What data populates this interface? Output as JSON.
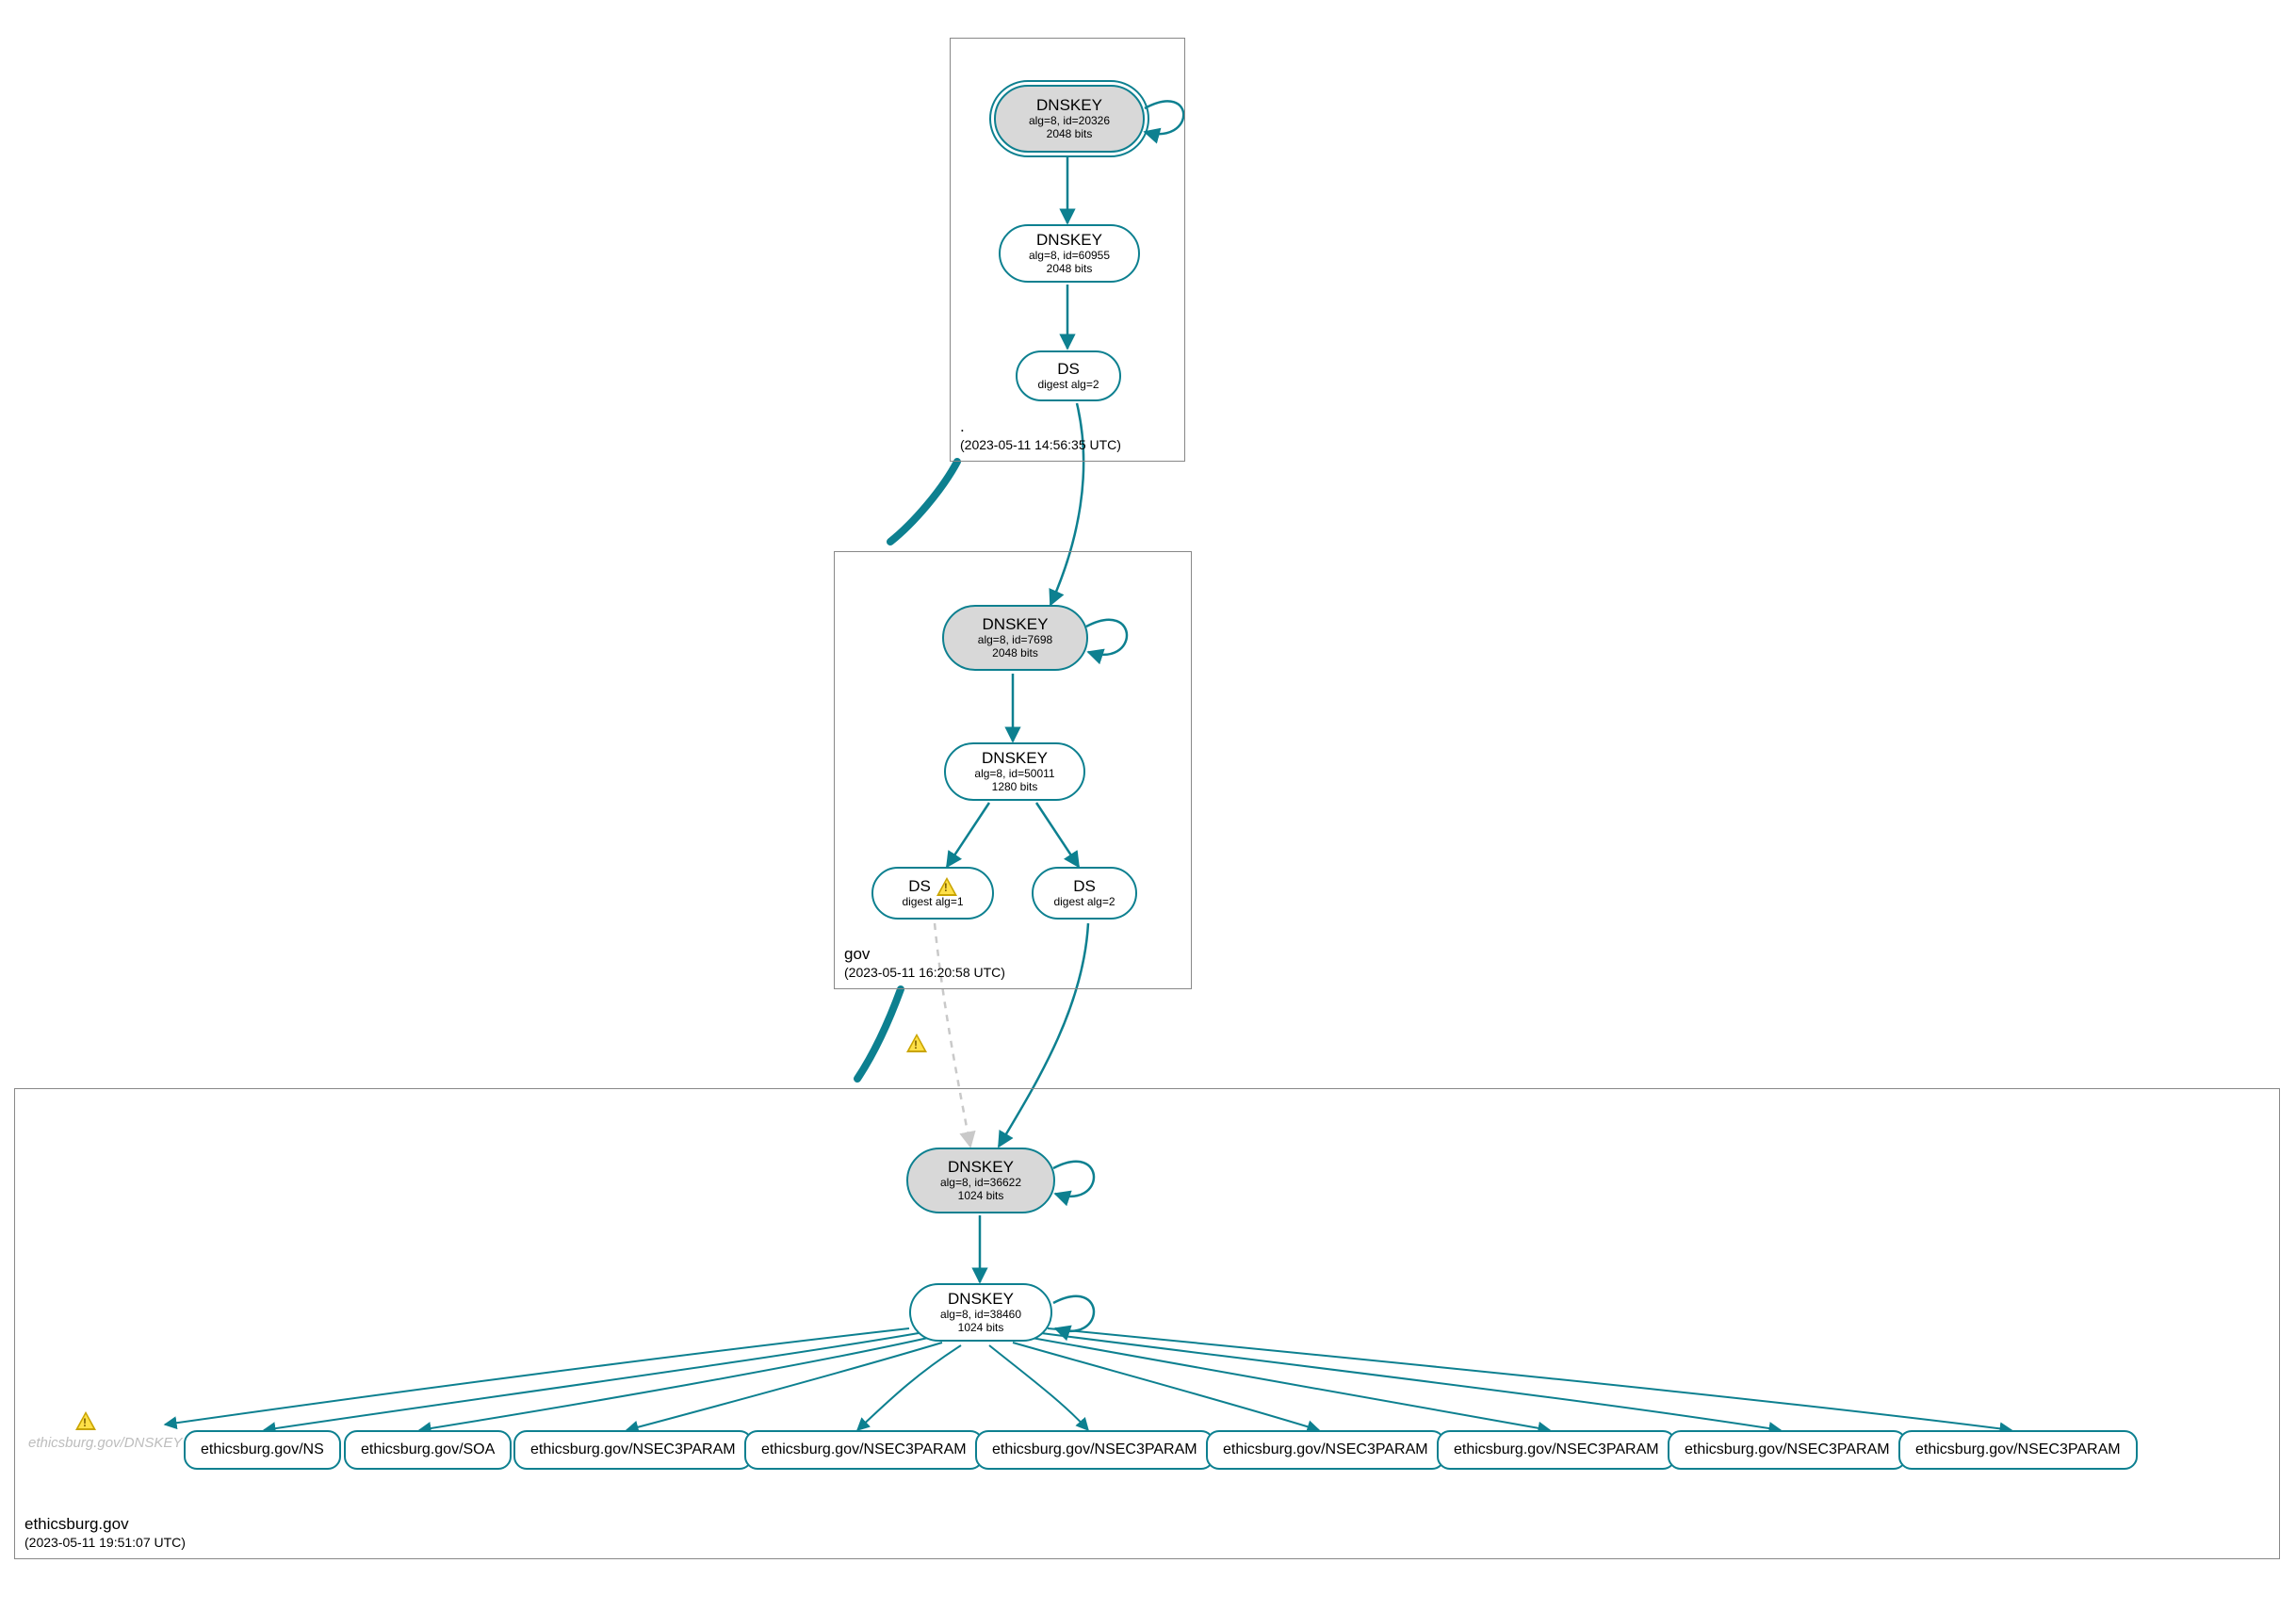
{
  "colors": {
    "edge": "#0d8090",
    "zone_border": "#888888",
    "node_fill_gray": "#d8d8d8"
  },
  "zones": {
    "root": {
      "label": ".",
      "timestamp": "(2023-05-11 14:56:35 UTC)"
    },
    "gov": {
      "label": "gov",
      "timestamp": "(2023-05-11 16:20:58 UTC)"
    },
    "leaf": {
      "label": "ethicsburg.gov",
      "timestamp": "(2023-05-11 19:51:07 UTC)"
    }
  },
  "nodes": {
    "root_ksk": {
      "title": "DNSKEY",
      "sub1": "alg=8, id=20326",
      "sub2": "2048 bits"
    },
    "root_zsk": {
      "title": "DNSKEY",
      "sub1": "alg=8, id=60955",
      "sub2": "2048 bits"
    },
    "root_ds": {
      "title": "DS",
      "sub1": "digest alg=2"
    },
    "gov_ksk": {
      "title": "DNSKEY",
      "sub1": "alg=8, id=7698",
      "sub2": "2048 bits"
    },
    "gov_zsk": {
      "title": "DNSKEY",
      "sub1": "alg=8, id=50011",
      "sub2": "1280 bits"
    },
    "gov_ds1": {
      "title": "DS",
      "sub1": "digest alg=1",
      "warn": true
    },
    "gov_ds2": {
      "title": "DS",
      "sub1": "digest alg=2"
    },
    "leaf_ksk": {
      "title": "DNSKEY",
      "sub1": "alg=8, id=36622",
      "sub2": "1024 bits"
    },
    "leaf_zsk": {
      "title": "DNSKEY",
      "sub1": "alg=8, id=38460",
      "sub2": "1024 bits"
    }
  },
  "ghost_key_label": "ethicsburg.gov/DNSKEY",
  "records": {
    "r0": "ethicsburg.gov/NS",
    "r1": "ethicsburg.gov/SOA",
    "r2": "ethicsburg.gov/NSEC3PARAM",
    "r3": "ethicsburg.gov/NSEC3PARAM",
    "r4": "ethicsburg.gov/NSEC3PARAM",
    "r5": "ethicsburg.gov/NSEC3PARAM",
    "r6": "ethicsburg.gov/NSEC3PARAM",
    "r7": "ethicsburg.gov/NSEC3PARAM",
    "r8": "ethicsburg.gov/NSEC3PARAM"
  }
}
